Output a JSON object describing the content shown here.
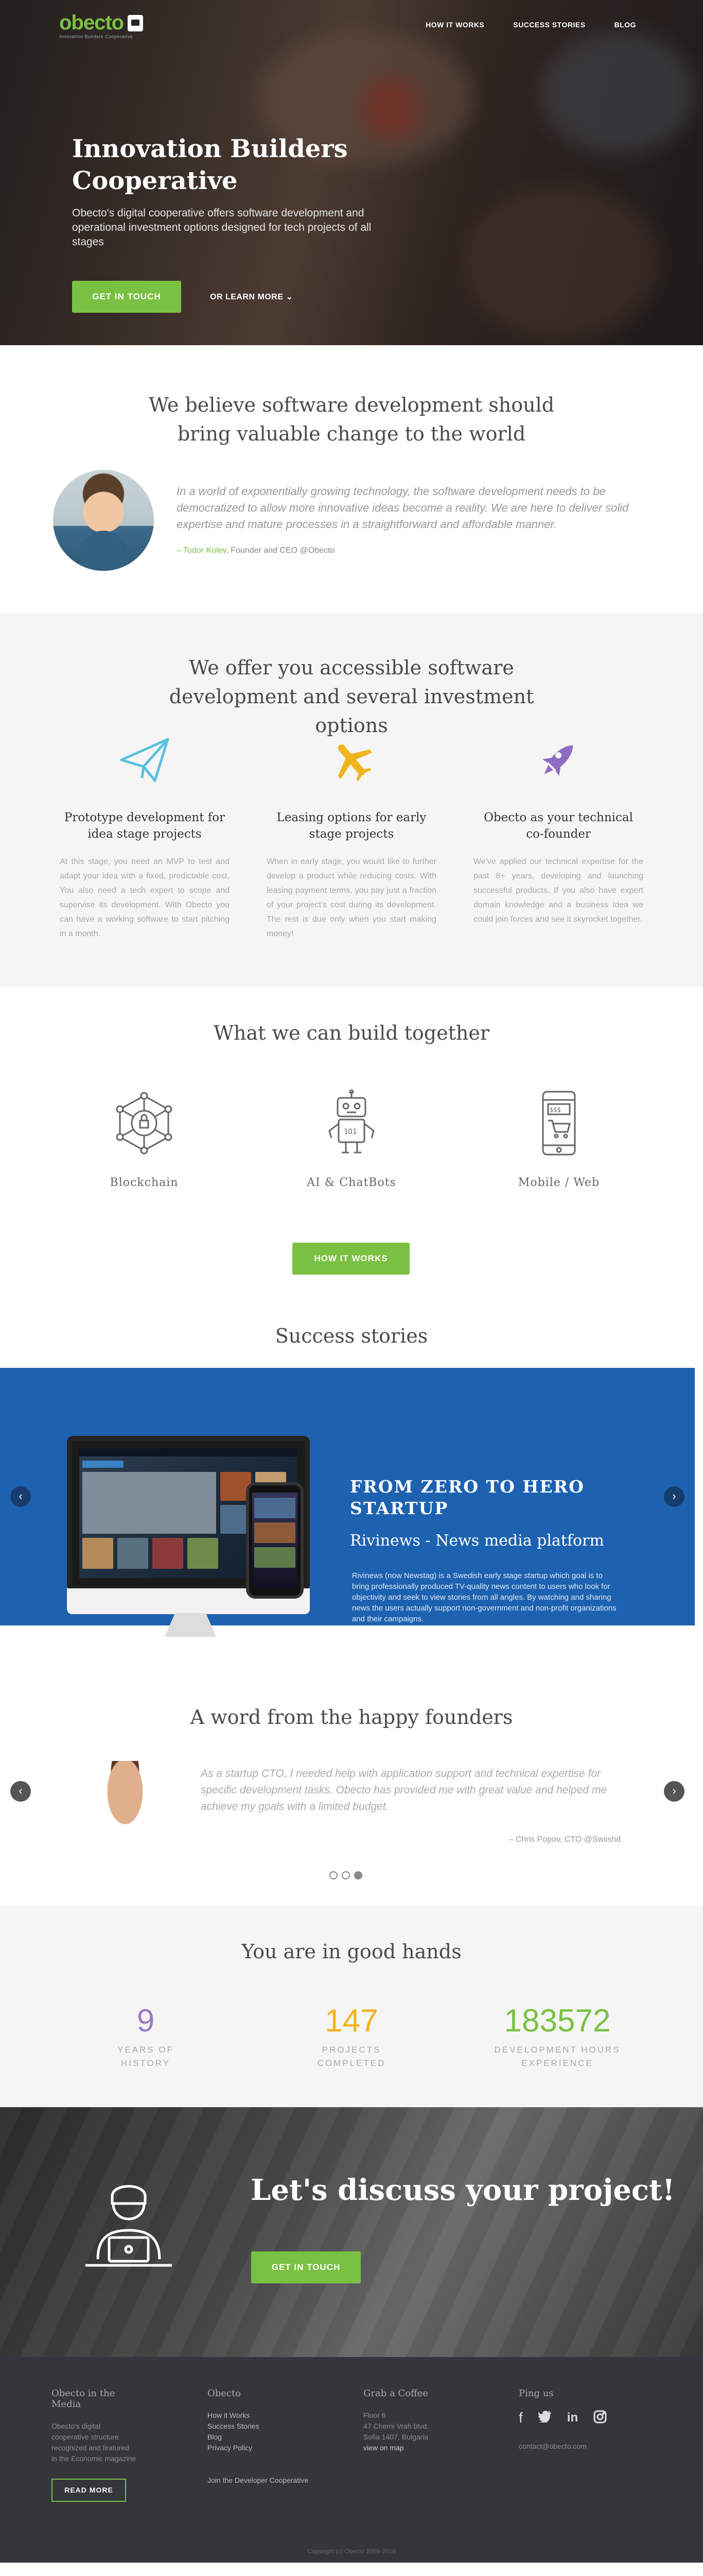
{
  "brand": {
    "name": "obecto",
    "tagline": "Innovation Builders Cooperative"
  },
  "nav": {
    "items": [
      "HOW IT WORKS",
      "SUCCESS STORIES",
      "BLOG"
    ]
  },
  "hero": {
    "title": "Innovation Builders Cooperative",
    "text": "Obecto's digital cooperative offers software development and operational investment options designed for tech projects of all stages",
    "cta": "GET IN TOUCH",
    "more": "OR LEARN MORE ⌄"
  },
  "believe": {
    "title": "We believe software development should bring valuable change to the world",
    "quote": "In a world of exponentially growing technology, the software development needs to be democratized to allow more innovative ideas become a reality. We are here to deliver solid expertise and mature processes in a straightforward and affordable manner.",
    "author": "– Todor Kolev",
    "role": ", Founder and CEO @Obecto"
  },
  "offer": {
    "title": "We offer you accessible software development and several investment options",
    "columns": [
      {
        "title": "Prototype development for idea stage projects",
        "text": "At this stage, you need an MVP to test and adapt your idea with a fixed, predictable cost. You also need a tech expert to scope and supervise its development. With Obecto you can have a working software to start pitching in a month.",
        "icon": "paper-plane-icon",
        "color": "#5bc0de"
      },
      {
        "title": "Leasing options for early stage projects",
        "text": "When in early stage, you would like to further develop a product while reducing costs. With leasing payment terms, you pay just a fraction of your project's cost during its development. The rest is due only when you start making money!",
        "icon": "airplane-icon",
        "color": "#f0b51e"
      },
      {
        "title": "Obecto as your technical co-founder",
        "text": "We've applied our technical expertise for the past 8+ years, developing and launching successful products. If you also have expert domain knowledge and a business idea we could join forces and see it skyrocket together.",
        "icon": "rocket-icon",
        "color": "#8e6cc4"
      }
    ]
  },
  "build": {
    "title": "What we can build together",
    "items": [
      {
        "label": "Blockchain",
        "icon": "blockchain-icon"
      },
      {
        "label": "AI & ChatBots",
        "icon": "robot-icon"
      },
      {
        "label": "Mobile / Web",
        "icon": "mobile-cart-icon"
      }
    ],
    "cta": "HOW IT WORKS"
  },
  "success": {
    "title": "Success stories",
    "headline": "FROM ZERO TO HERO STARTUP",
    "project": "Rivinews - News media platform",
    "description": "Rivinews (now Newstag) is a Swedish early stage startup which goal is to bring professionally produced TV-quality news content to users who look for objectivity and seek to view stories from all angles. By watching and sharing news the users actually support non-government and non-profit organizations and their campaigns.",
    "prev": "‹",
    "next": "›"
  },
  "founders": {
    "title": "A word from the happy founders",
    "quote": "As a startup CTO, I needed help with application support and technical expertise for specific development tasks. Obecto has provided me with great value and helped me achieve my goals with a limited budget.",
    "author": "– Chris Popov, CTO @Swiishd",
    "prev": "‹",
    "next": "›",
    "active_slide": 3
  },
  "hands": {
    "title": "You are in good hands",
    "stats": [
      {
        "value": "9",
        "label": "YEARS OF HISTORY",
        "color": "#9b7cc9"
      },
      {
        "value": "147",
        "label": "PROJECTS COMPLETED",
        "color": "#f0b51e"
      },
      {
        "value": "183572",
        "label": "DEVELOPMENT HOURS EXPERIENCE",
        "color": "#7ac143"
      }
    ]
  },
  "cta": {
    "title": "Let's discuss your project!",
    "button": "GET IN TOUCH"
  },
  "footer": {
    "media": {
      "title": "Obecto in the Media",
      "text": "Obecto's digital cooperative structure recognized and featured in the Economic magazine",
      "button": "READ MORE"
    },
    "obecto": {
      "title": "Obecto",
      "links": [
        "How it Works",
        "Success Stories",
        "Blog",
        "Privacy Policy"
      ],
      "join": "Join the Developer Cooperative"
    },
    "coffee": {
      "title": "Grab a Coffee",
      "lines": [
        "Floor 6",
        "47 Cherni Vrah blvd.",
        "Sofia 1407, Bulgaria",
        "view on map"
      ]
    },
    "ping": {
      "title": "Ping us",
      "email": "contact@obecto.com",
      "social": [
        "f",
        "t",
        "in",
        "ig"
      ]
    },
    "copyright": "Copyright (c) Obecto 2009-2019"
  }
}
